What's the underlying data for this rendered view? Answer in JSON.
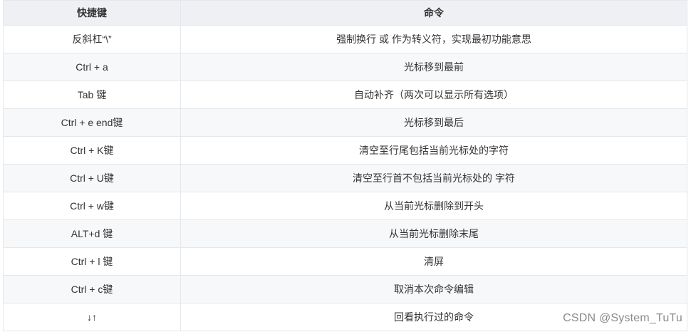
{
  "table": {
    "headers": [
      "快捷键",
      "命令"
    ],
    "rows": [
      [
        "反斜杠“\\”",
        "强制换行 或 作为转义符，实现最初功能意思"
      ],
      [
        "Ctrl + a",
        "光标移到最前"
      ],
      [
        "Tab 键",
        "自动补齐（两次可以显示所有选项）"
      ],
      [
        "Ctrl + e end键",
        "光标移到最后"
      ],
      [
        "Ctrl + K键",
        "清空至行尾包括当前光标处的字符"
      ],
      [
        "Ctrl + U键",
        "清空至行首不包括当前光标处的 字符"
      ],
      [
        "Ctrl + w键",
        "从当前光标删除到开头"
      ],
      [
        "ALT+d 键",
        "从当前光标删除末尾"
      ],
      [
        "Ctrl + l 键",
        "清屏"
      ],
      [
        "Ctrl + c键",
        "取消本次命令编辑"
      ],
      [
        "↓↑",
        "回看执行过的命令"
      ]
    ]
  },
  "watermark": "CSDN @System_TuTu"
}
